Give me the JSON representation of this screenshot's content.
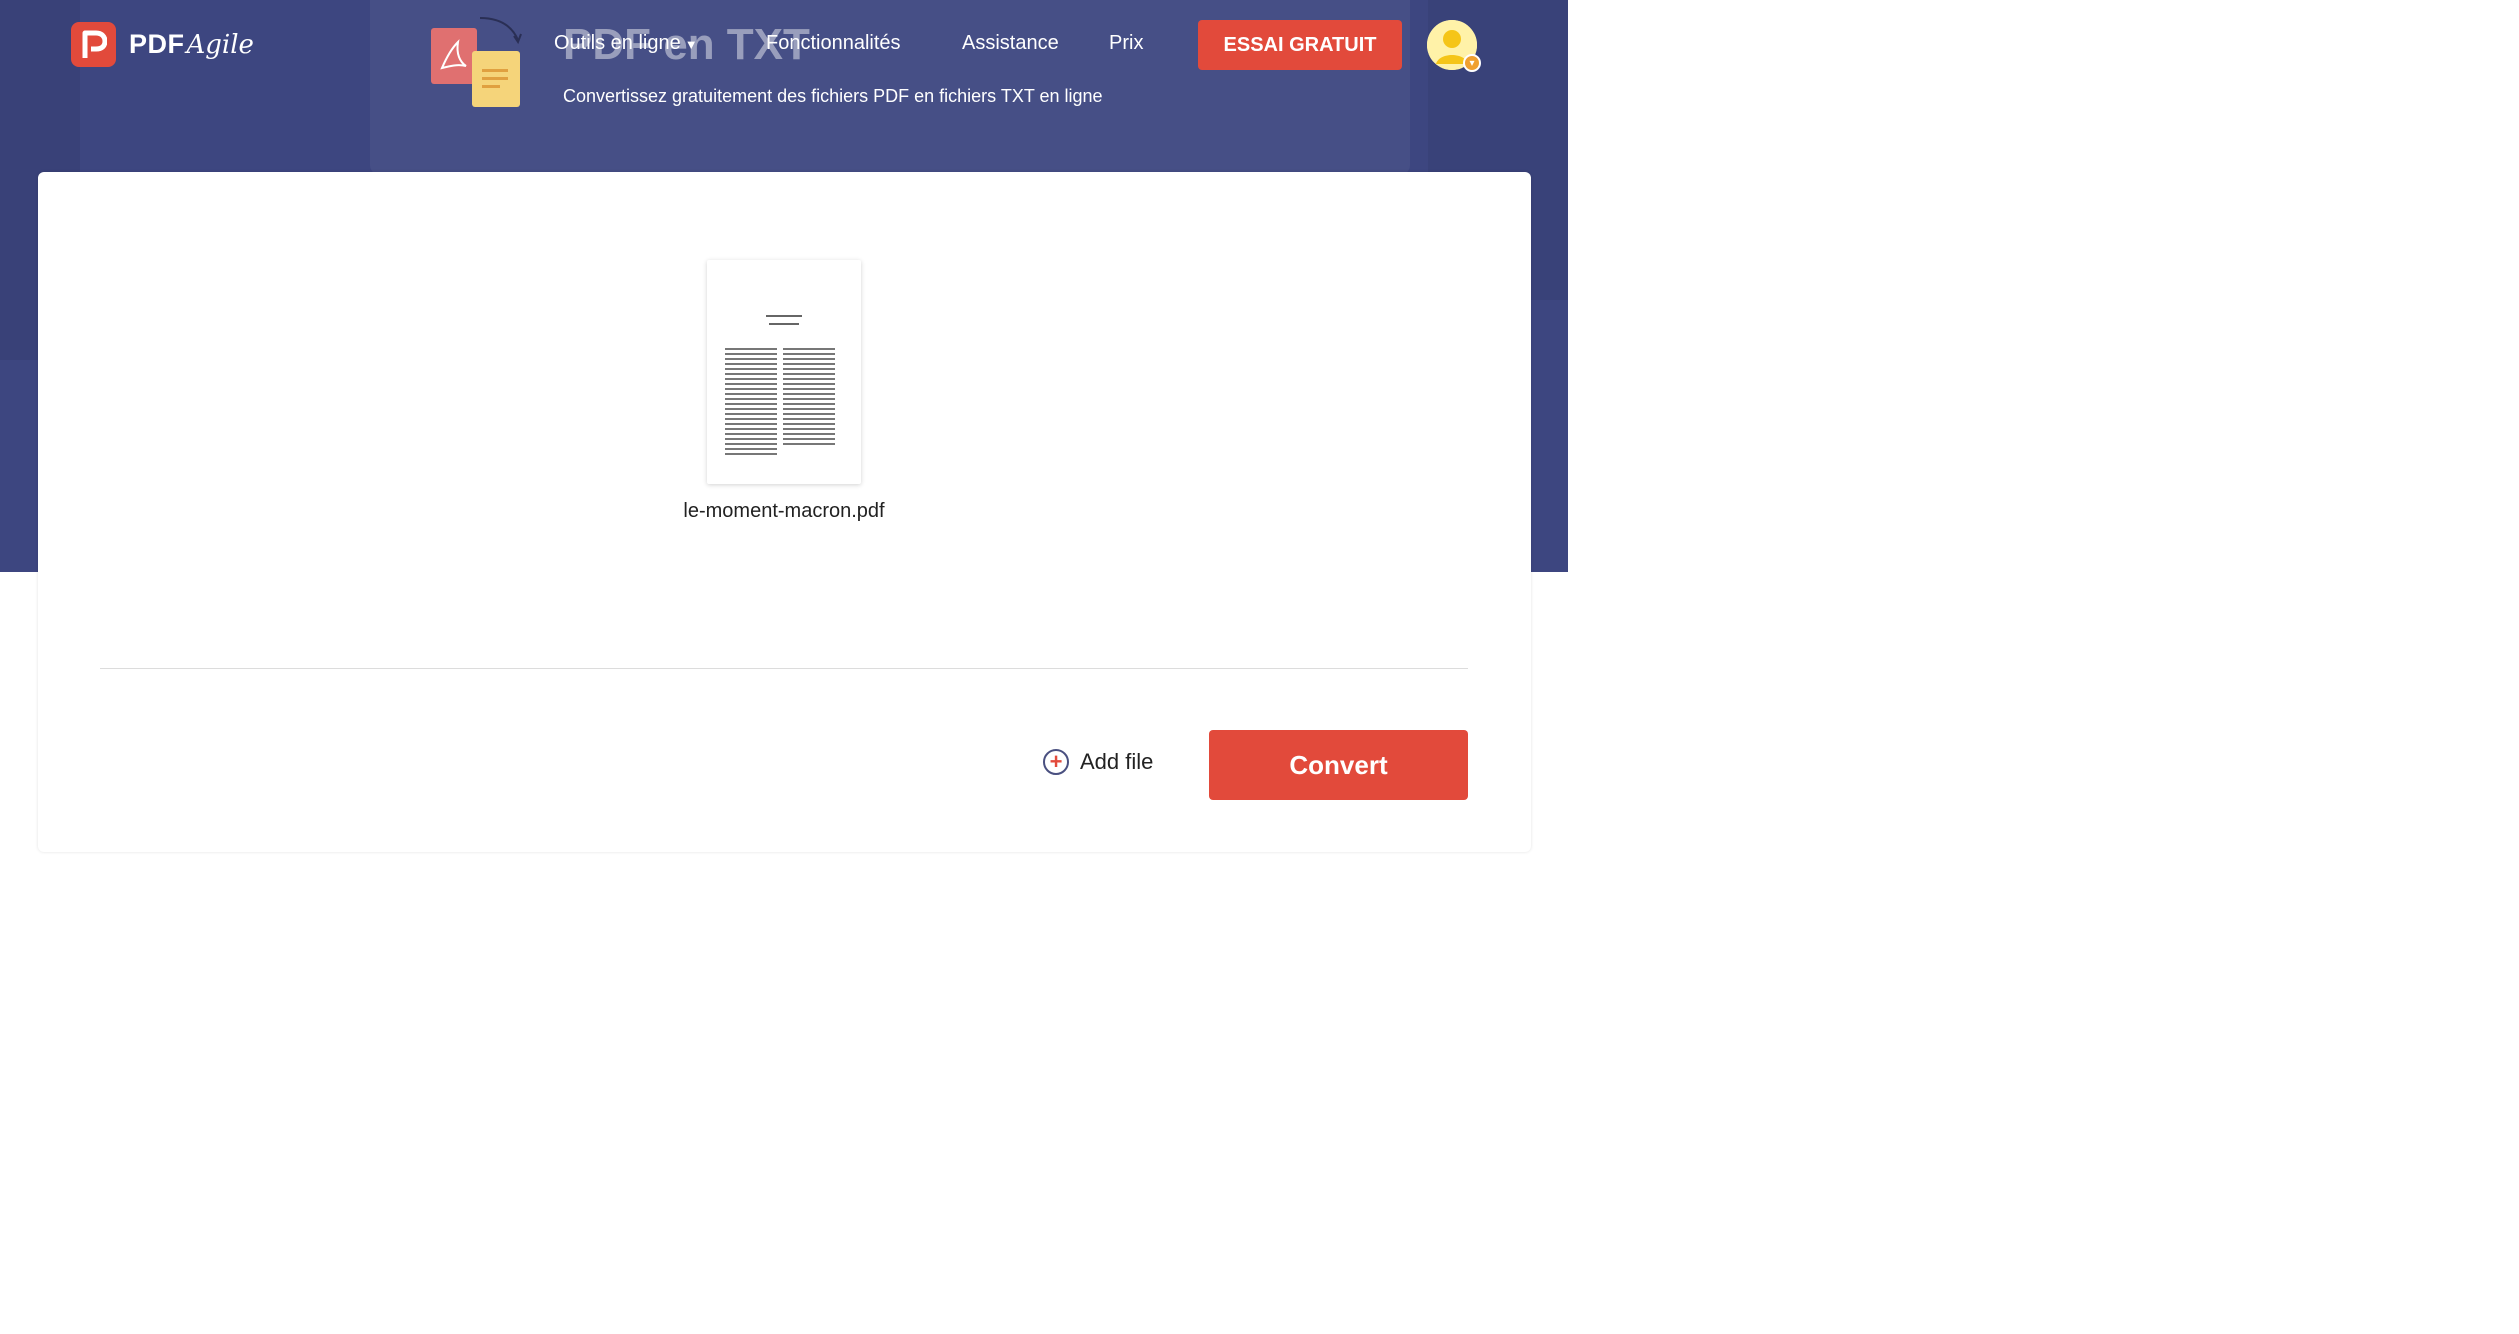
{
  "brand": {
    "name": "PDF",
    "script": "Agile"
  },
  "nav": {
    "tools_label": "Outils en ligne",
    "features_label": "Fonctionnalités",
    "help_label": "Assistance",
    "price_label": "Prix",
    "trial_label": "ESSAI GRATUIT"
  },
  "hero": {
    "title": "PDF en TXT",
    "subtitle": "Convertissez gratuitement des fichiers PDF en fichiers TXT en ligne"
  },
  "file": {
    "name": "le-moment-macron.pdf"
  },
  "actions": {
    "add_file_label": "Add file",
    "convert_label": "Convert"
  },
  "colors": {
    "hero_bg": "#3d4680",
    "accent": "#e24a3b"
  }
}
